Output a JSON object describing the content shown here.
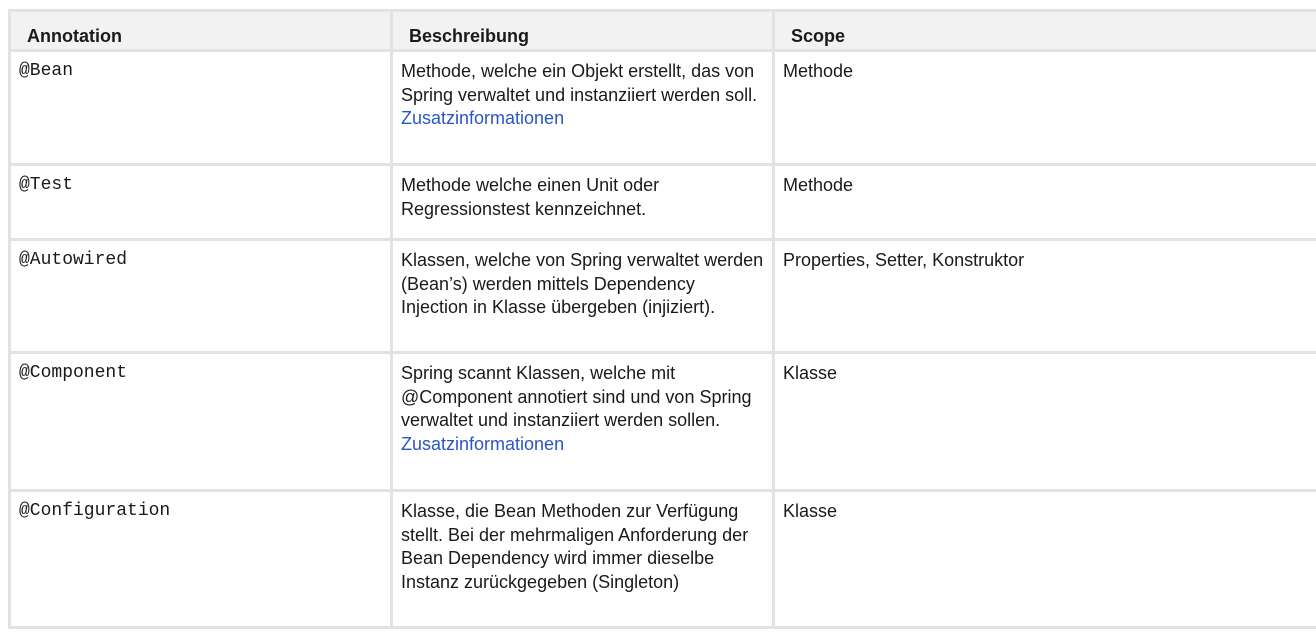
{
  "table": {
    "headers": {
      "annotation": "Annotation",
      "description": "Beschreibung",
      "scope": "Scope"
    },
    "rows": [
      {
        "annotation": "@Bean",
        "description": "Methode, welche ein Objekt erstellt, das von Spring verwaltet und instanziiert werden soll.",
        "link": "Zusatzinformationen",
        "scope": "Methode"
      },
      {
        "annotation": "@Test",
        "description": "Methode welche einen Unit oder Regressionstest kennzeichnet.",
        "link": "",
        "scope": "Methode"
      },
      {
        "annotation": "@Autowired",
        "description": "Klassen, welche von Spring verwaltet werden (Bean’s) werden mittels Dependency Injection in Klasse übergeben (injiziert).",
        "link": "",
        "scope": "Properties, Setter, Konstruktor"
      },
      {
        "annotation": "@Component",
        "description": "Spring scannt Klassen, welche mit @Component annotiert sind und von Spring verwaltet und instanziiert werden sollen.",
        "link": "Zusatzinformationen",
        "scope": "Klasse"
      },
      {
        "annotation": "@Configuration",
        "description": "Klasse, die Bean Methoden zur Verfügung stellt. Bei der mehrmaligen Anforderung der Bean Dependency wird immer dieselbe Instanz zurückgegeben (Singleton)",
        "link": "",
        "scope": "Klasse"
      }
    ]
  },
  "colors": {
    "link": "#2a55c4",
    "header_bg": "#f2f2f2",
    "border": "#e2e2e2"
  }
}
